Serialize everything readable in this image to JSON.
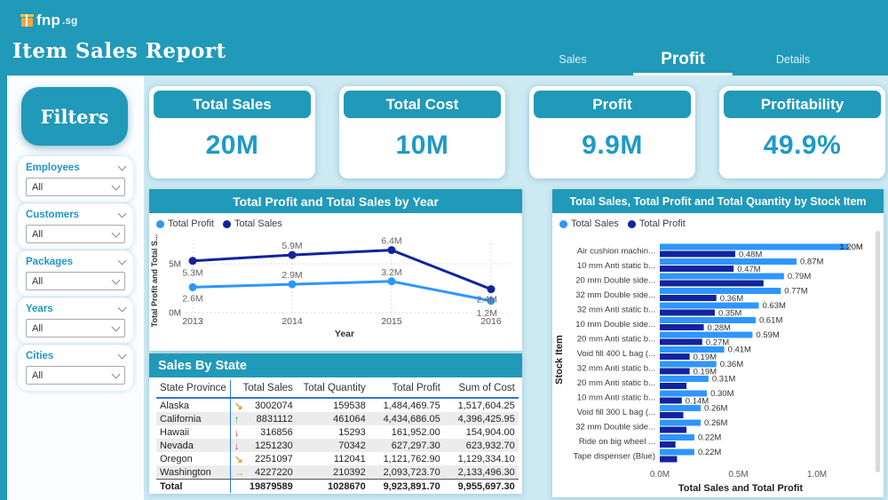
{
  "header": {
    "logo": {
      "brand": "fnp",
      "suffix": ".sg",
      "icon": "gift-icon"
    },
    "title": "Item Sales Report",
    "tabs": [
      {
        "label": "Sales",
        "active": false
      },
      {
        "label": "Profit",
        "active": true
      },
      {
        "label": "Details",
        "active": false
      }
    ]
  },
  "filters": {
    "title": "Filters",
    "groups": [
      {
        "label": "Employees",
        "value": "All"
      },
      {
        "label": "Customers",
        "value": "All"
      },
      {
        "label": "Packages",
        "value": "All"
      },
      {
        "label": "Years",
        "value": "All"
      },
      {
        "label": "Cities",
        "value": "All"
      }
    ]
  },
  "kpis": [
    {
      "label": "Total Sales",
      "value": "20M"
    },
    {
      "label": "Total Cost",
      "value": "10M"
    },
    {
      "label": "Profit",
      "value": "9.9M"
    },
    {
      "label": "Profitability",
      "value": "49.9%"
    }
  ],
  "colors": {
    "teal": "#2199B8",
    "body_bg": "#CDE9F2",
    "series_blue": "#2E96FF",
    "series_navy": "#12239E",
    "kpi_value": "#1E9AC6",
    "table_accent": "#2E75E6",
    "trend_up": "#3BA33B",
    "trend_down": "#CC4040",
    "trend_flat": "#E2A33C"
  },
  "chart_data": [
    {
      "type": "line",
      "title": "Total Profit and Total Sales by Year",
      "x": [
        "2013",
        "2014",
        "2015",
        "2016"
      ],
      "xlabel": "Year",
      "ylabel": "Total Profit and Total S...",
      "ylim": [
        0,
        7
      ],
      "yticks": [
        {
          "v": 0,
          "label": "0M"
        },
        {
          "v": 5,
          "label": "5M"
        }
      ],
      "grid": true,
      "legend_position": "top-left",
      "series": [
        {
          "name": "Total Profit",
          "color": "#2E96FF",
          "values": [
            2.6,
            2.9,
            3.2,
            1.2
          ],
          "labels": [
            "2.6M",
            "2.9M",
            "3.2M",
            "1.2M"
          ]
        },
        {
          "name": "Total Sales",
          "color": "#12239E",
          "values": [
            5.3,
            5.9,
            6.4,
            2.4
          ],
          "labels": [
            "5.3M",
            "5.9M",
            "6.4M",
            "2.4M"
          ]
        }
      ]
    },
    {
      "type": "bar",
      "orientation": "horizontal",
      "title": "Total Sales, Total Profit and Total Quantity by Stock Item",
      "xlabel": "Total Sales and Total Profit",
      "ylabel": "Stock Item",
      "xlim": [
        0,
        1.4
      ],
      "xticks": [
        {
          "v": 0,
          "label": "0.0M"
        },
        {
          "v": 0.5,
          "label": "0.5M"
        },
        {
          "v": 1.0,
          "label": "1.0M"
        }
      ],
      "categories": [
        "Air cushion machin...",
        "10 mm Anti static b...",
        "20 mm Double side...",
        "32 mm Double side...",
        "32 mm Anti static b...",
        "10 mm Double side...",
        "20 mm Anti static b...",
        "Void fill 400 L bag (...",
        "32 mm Anti static b...",
        "20 mm Anti static b...",
        "10 mm Anti static b...",
        "Void fill 300 L bag (...",
        "32 mm Double side...",
        "Ride on big wheel ...",
        "Tape dispenser (Blue)"
      ],
      "series": [
        {
          "name": "Total Sales",
          "color": "#2E96FF",
          "values": [
            1.2,
            0.87,
            0.79,
            0.77,
            0.63,
            0.61,
            0.59,
            0.41,
            0.36,
            0.31,
            0.3,
            0.26,
            0.26,
            0.22,
            0.22
          ],
          "labels": [
            "1.20M",
            "0.87M",
            "0.79M",
            "0.77M",
            "0.63M",
            "0.61M",
            "0.59M",
            "0.41M",
            "0.36M",
            "0.31M",
            "0.30M",
            "0.26M",
            "0.26M",
            "0.22M",
            "0.22M"
          ]
        },
        {
          "name": "Total Profit",
          "color": "#12239E",
          "values": [
            0.48,
            0.47,
            0.66,
            0.36,
            0.35,
            0.28,
            0.27,
            0.19,
            0.19,
            0.17,
            0.14,
            0.15,
            0.17,
            0.1,
            0.11
          ],
          "labels": [
            "0.48M",
            "0.47M",
            "",
            "0.36M",
            "0.35M",
            "0.28M",
            "0.27M",
            "0.19M",
            "0.19M",
            "",
            "0.14M",
            "",
            "",
            "",
            ""
          ]
        }
      ]
    }
  ],
  "state_table": {
    "title": "Sales By State",
    "columns": [
      "State Province",
      "Total Sales",
      "Total Quantity",
      "Total Profit",
      "Sum of Cost"
    ],
    "rows": [
      {
        "state": "Alaska",
        "trend": "down-right",
        "sales": "3002074",
        "qty": "159538",
        "profit": "1,484,469.75",
        "cost": "1,517,604.25"
      },
      {
        "state": "California",
        "trend": "up",
        "sales": "8831112",
        "qty": "461064",
        "profit": "4,434,686.05",
        "cost": "4,396,425.95"
      },
      {
        "state": "Hawaii",
        "trend": "down",
        "sales": "316856",
        "qty": "15293",
        "profit": "161,952.00",
        "cost": "154,904.00"
      },
      {
        "state": "Nevada",
        "trend": "down",
        "sales": "1251230",
        "qty": "70342",
        "profit": "627,297.30",
        "cost": "623,932.70"
      },
      {
        "state": "Oregon",
        "trend": "down-right",
        "sales": "2251097",
        "qty": "112041",
        "profit": "1,121,762.90",
        "cost": "1,129,334.10"
      },
      {
        "state": "Washington",
        "trend": "right",
        "sales": "4227220",
        "qty": "210392",
        "profit": "2,093,723.70",
        "cost": "2,133,496.30"
      }
    ],
    "total": {
      "state": "Total",
      "sales": "19879589",
      "qty": "1028670",
      "profit": "9,923,891.70",
      "cost": "9,955,697.30"
    },
    "trend_glyphs": {
      "up": "↑",
      "down": "↓",
      "down-right": "↘",
      "right": "→"
    },
    "trend_colors": {
      "up": "#3BA33B",
      "down": "#CC4040",
      "down-right": "#E2A33C",
      "right": "#E2A33C"
    }
  }
}
